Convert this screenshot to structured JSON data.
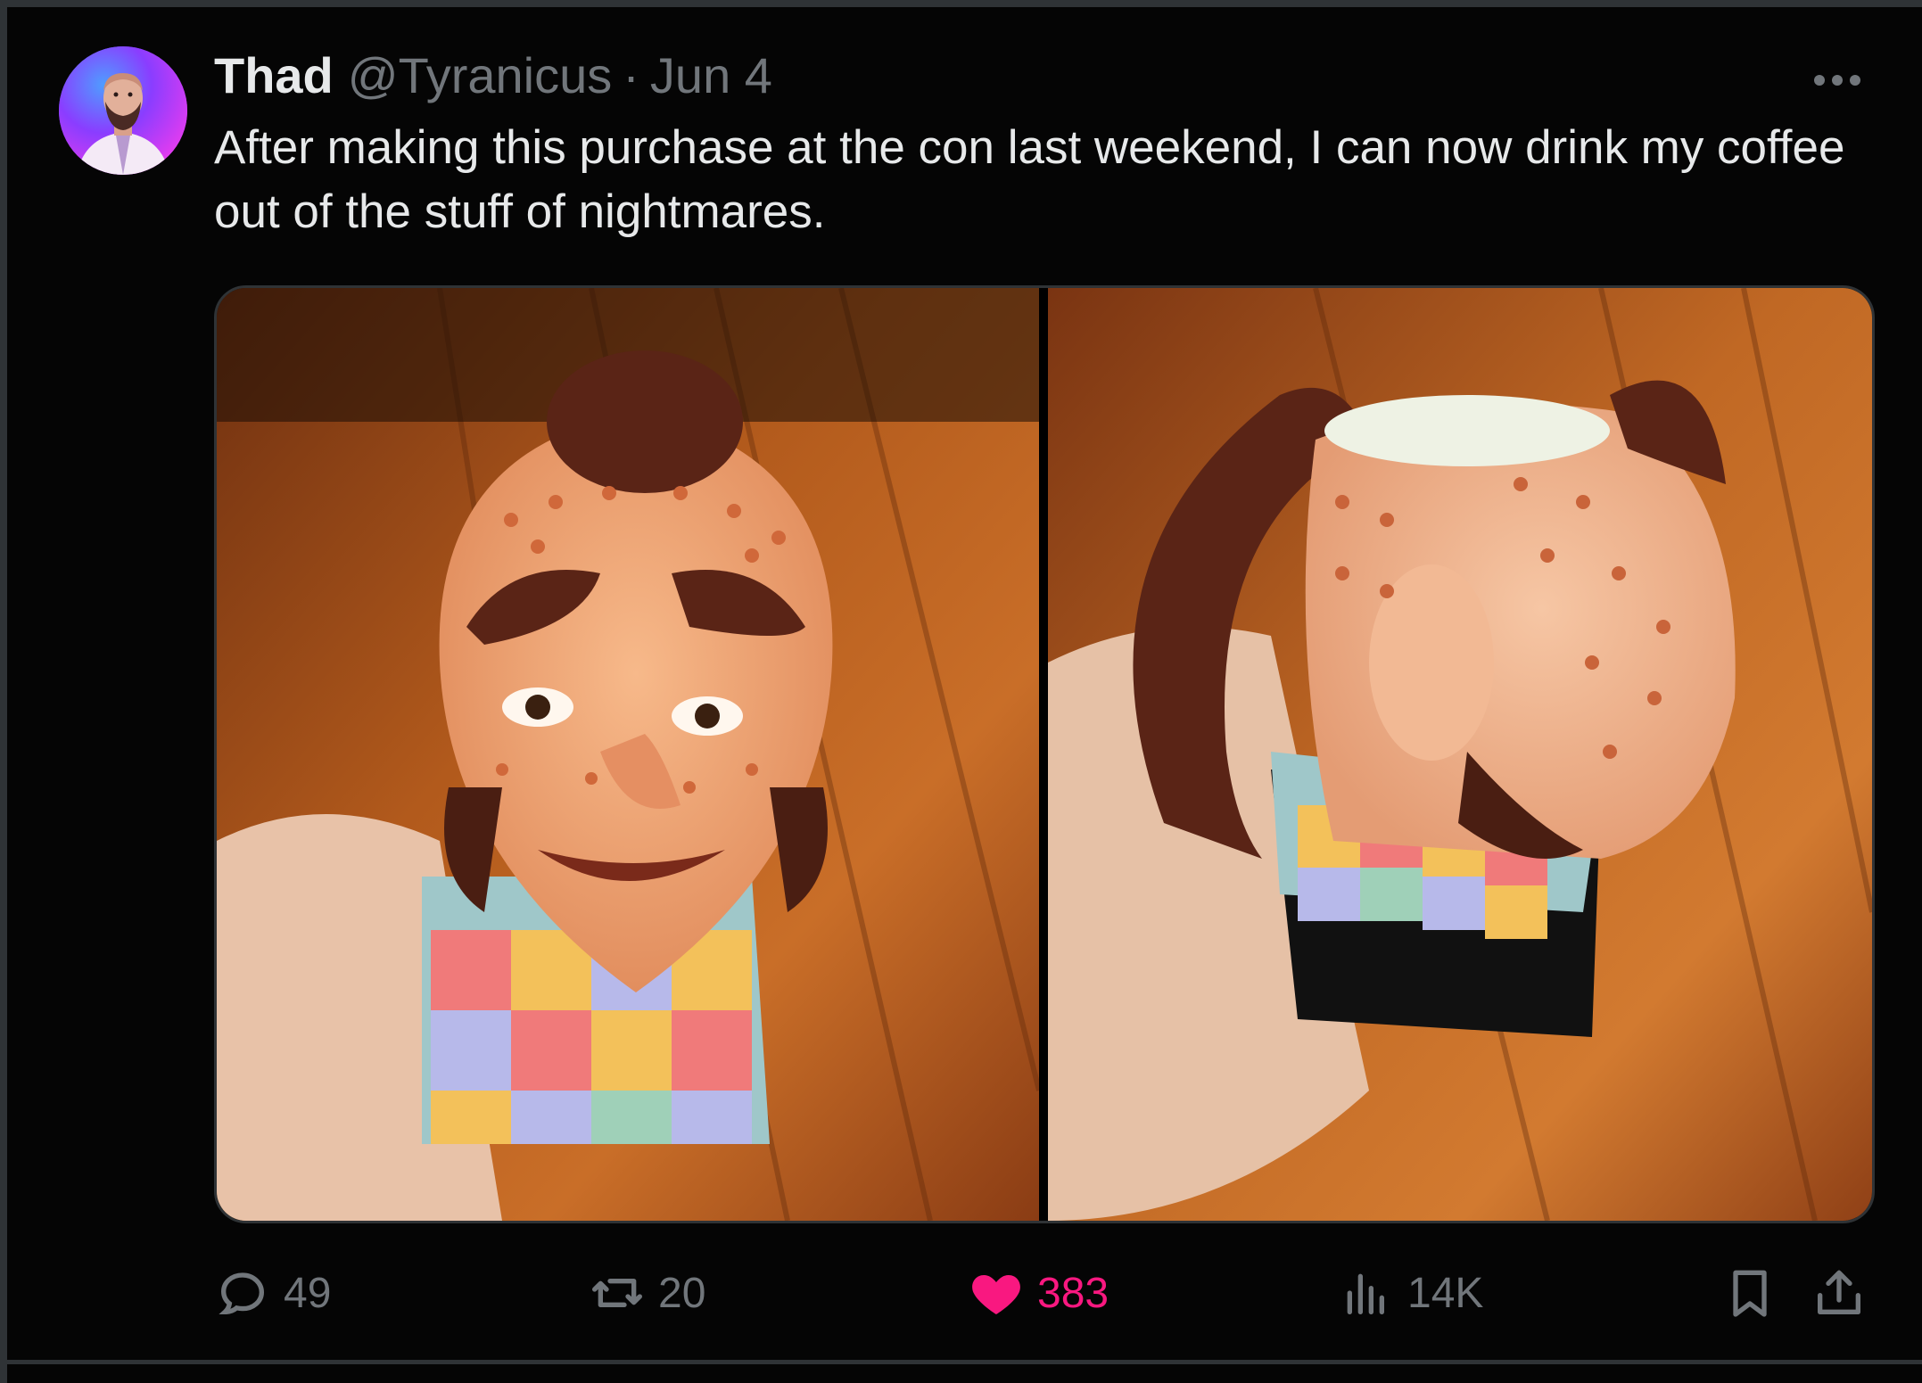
{
  "post": {
    "author_name": "Thad",
    "author_handle": "@Tyranicus",
    "separator": "·",
    "date": "Jun 4",
    "text": "After making this purchase at the con last weekend, I can now drink my coffee out of the stuff of nightmares."
  },
  "media": {
    "photos": [
      {
        "subject": "mug-front-view"
      },
      {
        "subject": "mug-side-view"
      }
    ]
  },
  "actions": {
    "replies": "49",
    "reposts": "20",
    "likes": "383",
    "views": "14K",
    "liked": true,
    "like_color": "#f91880"
  },
  "icons": {
    "reply": "reply-icon",
    "repost": "repost-icon",
    "like": "heart-icon",
    "views": "views-icon",
    "bookmark": "bookmark-icon",
    "share": "share-icon",
    "more": "more-icon"
  }
}
